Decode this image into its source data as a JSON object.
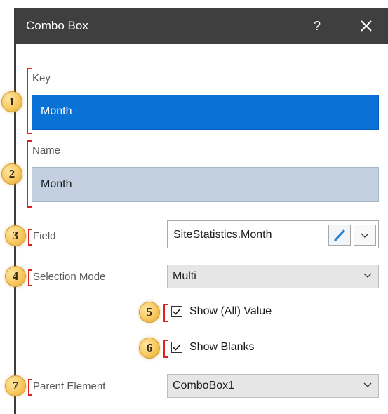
{
  "dialog": {
    "title": "Combo Box",
    "help_label": "?"
  },
  "badges": [
    "1",
    "2",
    "3",
    "4",
    "5",
    "6",
    "7"
  ],
  "key": {
    "label": "Key",
    "value": "Month"
  },
  "name": {
    "label": "Name",
    "value": "Month"
  },
  "field": {
    "label": "Field",
    "value": "SiteStatistics.Month"
  },
  "selection_mode": {
    "label": "Selection Mode",
    "value": "Multi"
  },
  "show_all": {
    "label": "Show (All) Value",
    "checked": true
  },
  "show_blanks": {
    "label": "Show Blanks",
    "checked": true
  },
  "parent_element": {
    "label": "Parent Element",
    "value": "ComboBox1"
  },
  "colors": {
    "title_bar": "#3f3f3f",
    "key_selected": "#0a72d6",
    "name_box": "#c2d0df",
    "annotation_red": "#e02020",
    "badge_gold": "#f7c85e"
  },
  "icons": [
    "question-icon",
    "close-icon",
    "pencil-icon",
    "chevron-down-icon",
    "checkmark-icon"
  ]
}
